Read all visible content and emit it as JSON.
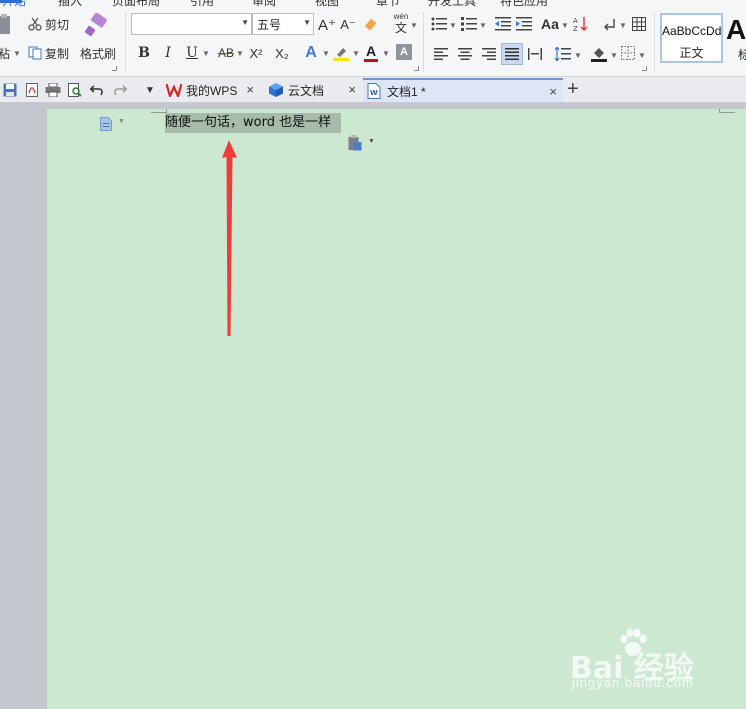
{
  "ribbon": {
    "tabs_cut": [
      "开始",
      "插入",
      "页面布局",
      "引用",
      "审阅",
      "视图",
      "章节",
      "开发工具",
      "特色应用"
    ],
    "clipboard": {
      "paste_label": "粘",
      "cut_label": "剪切",
      "copy_label": "复制",
      "format_painter_label": "格式刷"
    },
    "font": {
      "font_name_value": "",
      "font_size_value": "五号",
      "bold_label": "B",
      "italic_label": "I",
      "underline_label": "U",
      "strike_label": "AB",
      "super_label": "X²",
      "sub_label": "X₂",
      "grow_label": "A⁺",
      "shrink_label": "A⁻",
      "text_effect_label": "A",
      "font_color_label": "A",
      "char_shade_label": "A",
      "pinyin_label": "文",
      "pinyin_top": "wén"
    },
    "styles": {
      "normal_sample": "AaBbCcDd",
      "normal_name": "正文",
      "heading_sample": "A",
      "heading_name": "标"
    }
  },
  "docbar": {
    "tabs": [
      {
        "label": "我的WPS"
      },
      {
        "label": "云文档"
      },
      {
        "label": "文档1 *"
      }
    ]
  },
  "document": {
    "selected_text": "随便一句话，word 也是一样"
  },
  "watermark": {
    "logo": "Bai 经验",
    "url": "jingyan.baidu.com"
  },
  "colors": {
    "page_bg": "#cde8d1",
    "selection": "#a6bba9",
    "arrow": "#f23a3a",
    "accent": "#2a6fd6"
  }
}
